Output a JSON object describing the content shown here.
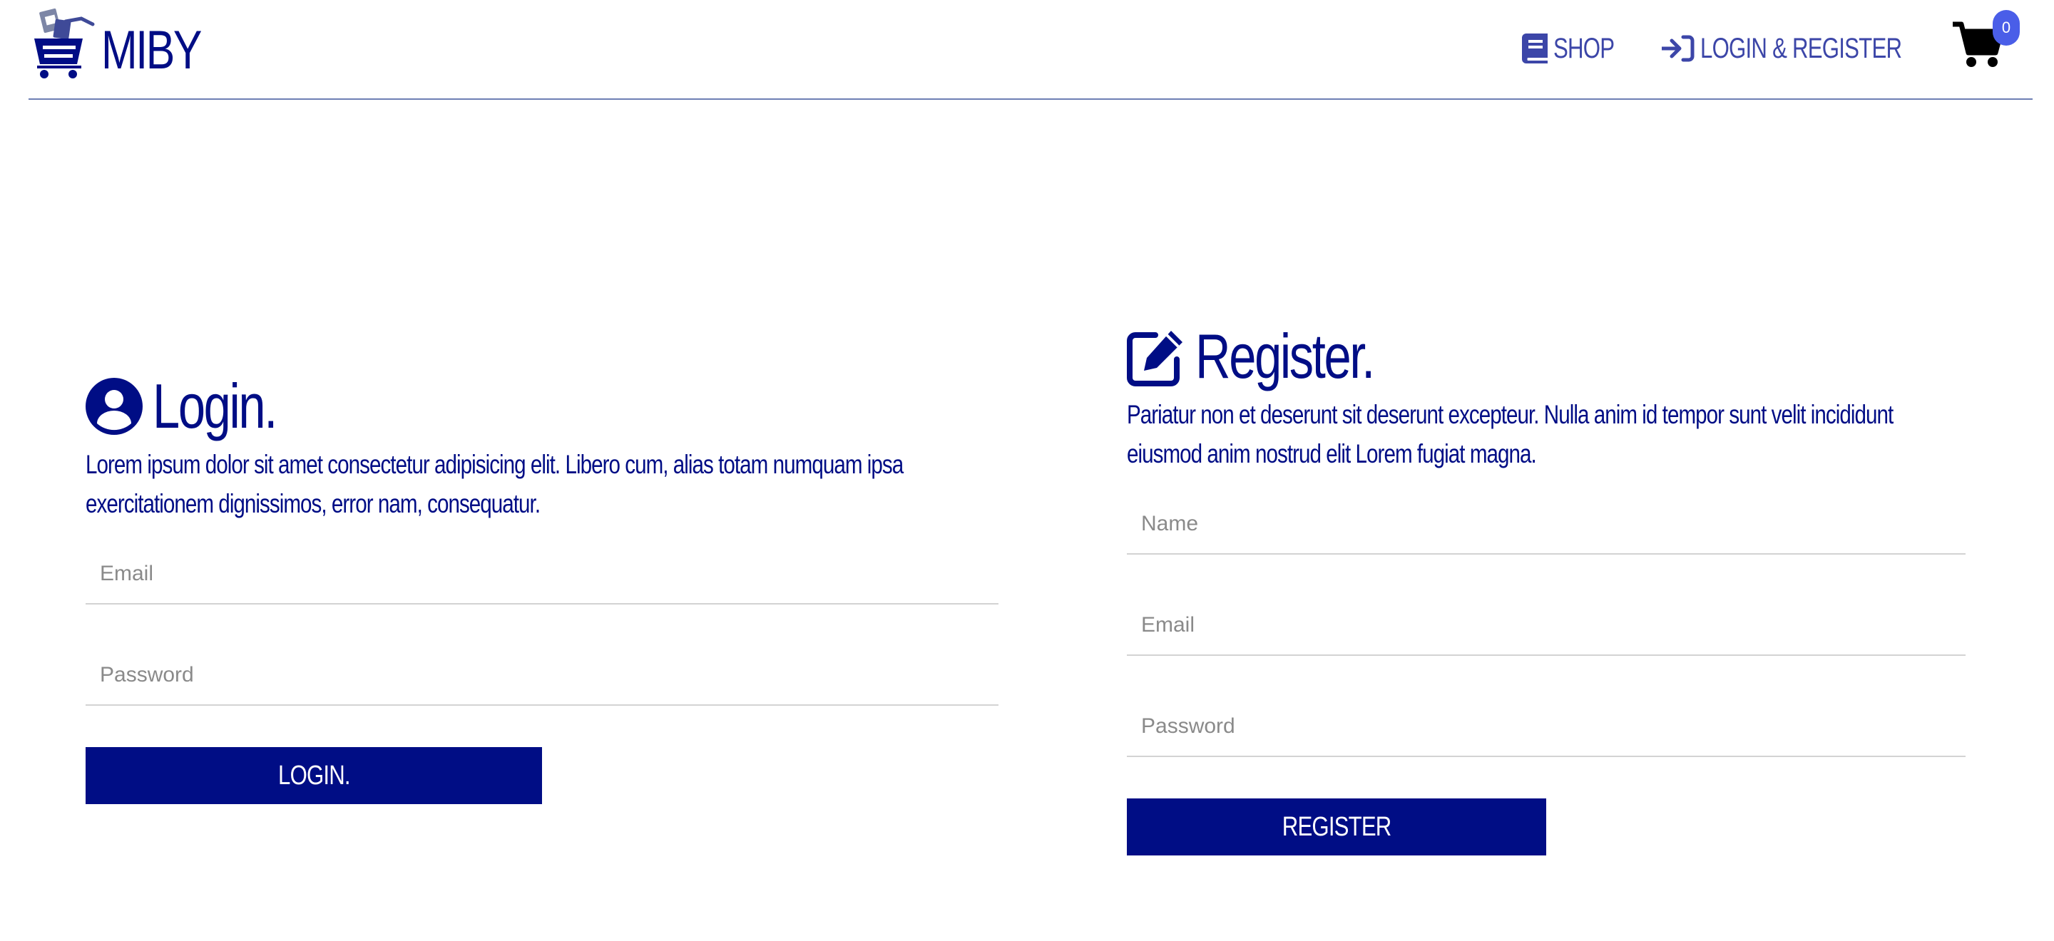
{
  "header": {
    "brand": "MIBY",
    "nav": {
      "shop_label": "SHOP",
      "shop_icon": "book-icon",
      "login_register_label": "LOGIN & REGISTER",
      "login_register_icon": "sign-in-icon"
    },
    "cart": {
      "icon": "shopping-cart-icon",
      "count": "0"
    }
  },
  "login": {
    "icon": "user-circle-icon",
    "title": "Login.",
    "description": "Lorem ipsum dolor sit amet consectetur adipisicing elit. Libero cum, alias totam numquam ipsa exercitationem dignissimos, error nam, consequatur.",
    "email_placeholder": "Email",
    "password_placeholder": "Password",
    "button_label": "LOGIN."
  },
  "register": {
    "icon": "edit-icon",
    "title": "Register.",
    "description": "Pariatur non et deserunt sit deserunt excepteur. Nulla anim id tempor sunt velit incididunt eiusmod anim nostrud elit Lorem fugiat magna.",
    "name_placeholder": "Name",
    "email_placeholder": "Email",
    "password_placeholder": "Password",
    "button_label": "REGISTER"
  },
  "colors": {
    "primary": "#000d85",
    "nav_text": "#3c46a8",
    "badge": "#4a5ee8",
    "divider": "#6e7fb4",
    "input_border": "#d3d3d3"
  }
}
